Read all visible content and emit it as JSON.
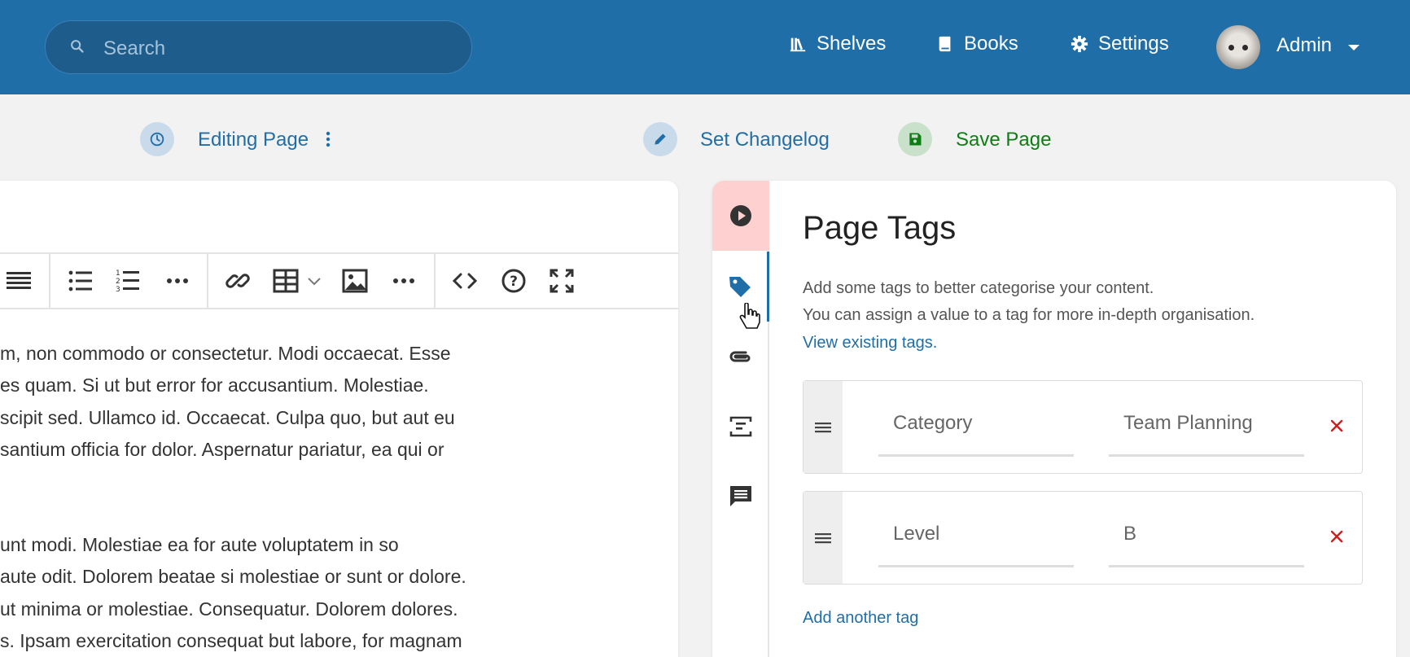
{
  "header": {
    "search_placeholder": "Search",
    "nav": [
      {
        "label": "Shelves",
        "icon": "shelves-icon"
      },
      {
        "label": "Books",
        "icon": "book-icon"
      },
      {
        "label": "Settings",
        "icon": "gear-icon"
      }
    ],
    "user": {
      "name": "Admin"
    }
  },
  "toolbar": {
    "editing_label": "Editing Page",
    "changelog_label": "Set Changelog",
    "save_label": "Save Page"
  },
  "editor": {
    "paragraph1": [
      "m, non commodo or consectetur. Modi occaecat. Esse",
      "es quam. Si ut but error for accusantium. Molestiae.",
      "scipit sed. Ullamco id. Occaecat. Culpa quo, but aut eu",
      "santium officia for dolor. Aspernatur pariatur, ea qui or"
    ],
    "paragraph2": [
      "unt modi. Molestiae ea for aute voluptatem in so",
      "aute odit. Dolorem beatae si molestiae or sunt or dolore.",
      "ut minima or molestiae. Consequatur. Dolorem dolores.",
      "s. Ipsam exercitation consequat but labore, for magnam"
    ]
  },
  "panel": {
    "title": "Page Tags",
    "desc1": "Add some tags to better categorise your content.",
    "desc2": "You can assign a value to a tag for more in-depth organisation.",
    "view_link": "View existing tags.",
    "tags": [
      {
        "name": "Category",
        "value": "Team Planning"
      },
      {
        "name": "Level",
        "value": "B"
      }
    ],
    "add_label": "Add another tag"
  },
  "colors": {
    "header_bg": "#206ea7",
    "link": "#206ea7",
    "save": "#0f7d15",
    "remove": "#cc1f1f",
    "active_tab_bg": "#ffd0d0"
  }
}
